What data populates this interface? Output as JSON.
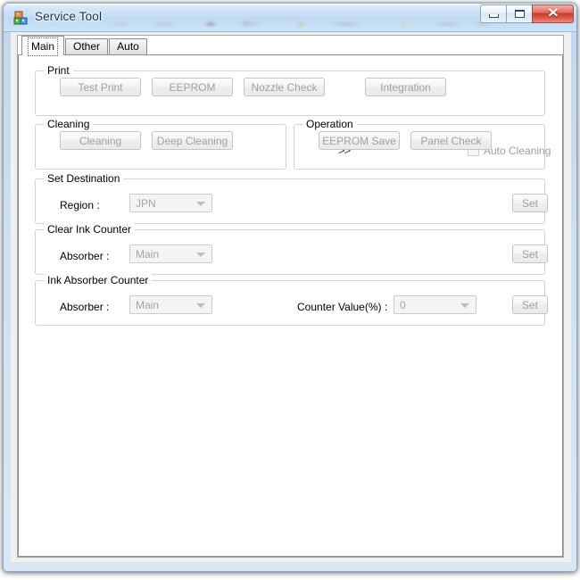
{
  "window": {
    "title": "Service Tool",
    "icon": "app-icon",
    "controls": {
      "minimize": "minimize-icon",
      "maximize": "maximize-icon",
      "close": "close-icon",
      "close_glyph": "✕"
    }
  },
  "tabs": [
    {
      "label": "Main",
      "selected": true
    },
    {
      "label": "Other",
      "selected": false
    },
    {
      "label": "Auto",
      "selected": false
    }
  ],
  "groups": {
    "print": {
      "title": "Print",
      "buttons": [
        {
          "label": "Test Print",
          "enabled": false
        },
        {
          "label": "EEPROM",
          "enabled": false
        },
        {
          "label": "Nozzle Check",
          "enabled": false
        },
        {
          "label": "Integration",
          "enabled": false
        }
      ],
      "chevron": ">>",
      "checkbox": {
        "label": "Auto Cleaning",
        "checked": false,
        "enabled": false
      }
    },
    "cleaning": {
      "title": "Cleaning",
      "buttons": [
        {
          "label": "Cleaning",
          "enabled": false
        },
        {
          "label": "Deep Cleaning",
          "enabled": false
        }
      ]
    },
    "operation": {
      "title": "Operation",
      "buttons": [
        {
          "label": "EEPROM Save",
          "enabled": false
        },
        {
          "label": "Panel Check",
          "enabled": false
        }
      ]
    },
    "set_destination": {
      "title": "Set Destination",
      "region_label": "Region :",
      "region_value": "JPN",
      "set_label": "Set"
    },
    "clear_ink_counter": {
      "title": "Clear Ink Counter",
      "absorber_label": "Absorber :",
      "absorber_value": "Main",
      "set_label": "Set"
    },
    "ink_absorber_counter": {
      "title": "Ink Absorber Counter",
      "absorber_label": "Absorber :",
      "absorber_value": "Main",
      "counter_label": "Counter Value(%) :",
      "counter_value": "0",
      "set_label": "Set"
    }
  },
  "colors": {
    "accent_title": "#12314e",
    "close_button": "#c9392c",
    "disabled_text": "#a0a0a0",
    "group_border": "#d3d3d3",
    "window_glass": "#c3dcf3"
  }
}
